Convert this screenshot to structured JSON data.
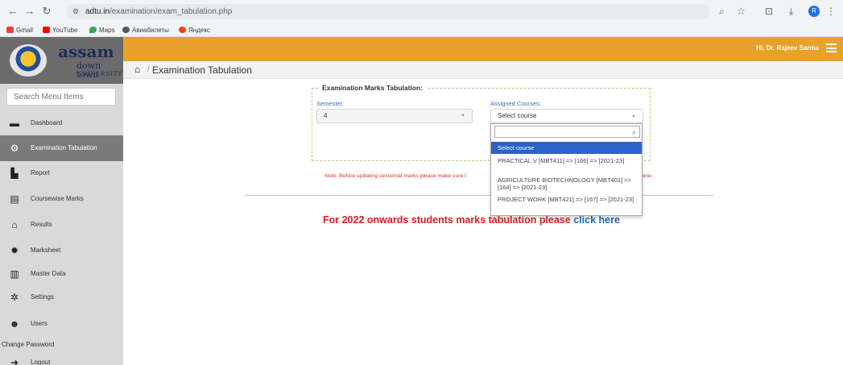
{
  "browser": {
    "url_host": "adtu.in",
    "url_path": "/examination/exam_tabulation.php",
    "bookmarks": [
      "Gmail",
      "YouTube",
      "Maps",
      "Авиабилеты",
      "Яндекс"
    ],
    "profile_initial": "R"
  },
  "logo": {
    "brand": "assam",
    "line2": "down town",
    "line3": "UNIVERSITY"
  },
  "sidebar": {
    "search_placeholder": "Search Menu Items",
    "items": [
      {
        "label": "Dashboard",
        "icon": "dashboard-icon"
      },
      {
        "label": "Examination Tabulation",
        "icon": "gears-icon"
      },
      {
        "label": "Report",
        "icon": "file-icon"
      },
      {
        "label": "Coursewise Marks",
        "icon": "document-icon"
      },
      {
        "label": "Results",
        "icon": "graduation-cap-icon"
      },
      {
        "label": "Marksheet",
        "icon": "certificate-icon"
      },
      {
        "label": "Master Data",
        "icon": "institution-icon"
      },
      {
        "label": "Settings",
        "icon": "gear-icon"
      },
      {
        "label": "Users",
        "icon": "users-icon"
      }
    ],
    "change_password": "Change Password",
    "logout": "Logout"
  },
  "header": {
    "greeting": "Hi, Dr. Rajeev Sarma"
  },
  "breadcrumb": {
    "title": "Examination Tabulation"
  },
  "form": {
    "legend": "Examination Marks Tabulation:",
    "semester_label": "Semester:",
    "semester_value": "4",
    "courses_label": "Assigned Courses:",
    "courses_value": "Select course"
  },
  "dropdown": {
    "options": [
      "Select course",
      "PRACTICAL V [MBT411] => [166] => [2021-23]",
      "AGRICULTURE BIOTECHNOLOGY [MBT401] => [164] => [2021-23]",
      "PROJECT WORK [MBT421] => [167] => [2021-23]"
    ]
  },
  "note": {
    "text": "Note: Before updating sessional marks please make sure t",
    "tail": "lone."
  },
  "promo": {
    "text": "For 2022 onwards students marks tabulation please ",
    "link": "click here"
  },
  "colors": {
    "topbar": "#e8a22a",
    "sidebar_active": "#7a7a7a",
    "note": "#d9302c",
    "promo": "#e11b1b",
    "link": "#1a6ab8"
  }
}
